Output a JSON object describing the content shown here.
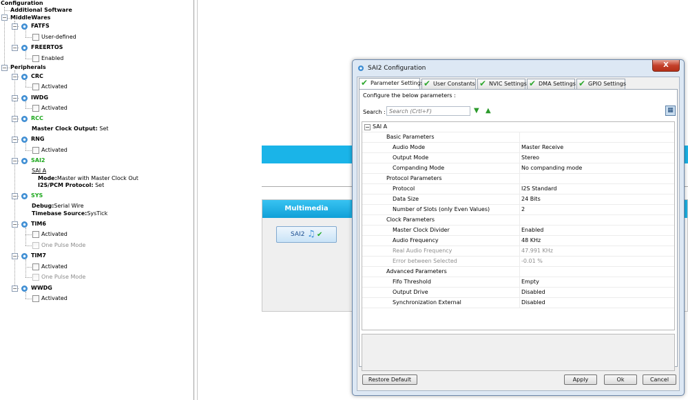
{
  "tree": {
    "root": "Configuration",
    "items": [
      {
        "label": "Additional Software"
      },
      {
        "label": "MiddleWares"
      },
      {
        "label": "FATFS"
      },
      {
        "label": "User-defined"
      },
      {
        "label": "FREERTOS"
      },
      {
        "label": "Enabled"
      },
      {
        "label": "Peripherals"
      },
      {
        "label": "CRC"
      },
      {
        "label": "Activated"
      },
      {
        "label": "IWDG"
      },
      {
        "label": "Activated"
      },
      {
        "label": "RCC"
      },
      {
        "label": "Master Clock Output:",
        "value": "Set"
      },
      {
        "label": "RNG"
      },
      {
        "label": "Activated"
      },
      {
        "label": "SAI2"
      },
      {
        "label": "SAI A"
      },
      {
        "label": "Mode:",
        "value": "Master with Master Clock Out"
      },
      {
        "label": "I2S/PCM Protocol:",
        "value": "Set"
      },
      {
        "label": "SYS"
      },
      {
        "label": "Debug:",
        "value": "Serial Wire"
      },
      {
        "label": "Timebase Source:",
        "value": "SysTick"
      },
      {
        "label": "TIM6"
      },
      {
        "label": "Activated"
      },
      {
        "label": "One Pulse Mode"
      },
      {
        "label": "TIM7"
      },
      {
        "label": "Activated"
      },
      {
        "label": "One Pulse Mode"
      },
      {
        "label": "WWDG"
      },
      {
        "label": "Activated"
      }
    ]
  },
  "multimedia": {
    "header": "Multimedia",
    "button_label": "SAI2"
  },
  "dialog": {
    "title": "SAI2 Configuration",
    "close_label": "X",
    "tabs": [
      {
        "label": "Parameter Settings"
      },
      {
        "label": "User Constants"
      },
      {
        "label": "NVIC Settings"
      },
      {
        "label": "DMA Settings"
      },
      {
        "label": "GPIO Settings"
      }
    ],
    "configure_label": "Configure the below parameters :",
    "search_label": "Search :",
    "search_placeholder": "Search (Crtl+F)",
    "section": "SAI A",
    "rows": [
      {
        "name": "Basic Parameters",
        "value": ""
      },
      {
        "name": "Audio Mode",
        "value": "Master Receive"
      },
      {
        "name": "Output Mode",
        "value": "Stereo"
      },
      {
        "name": "Companding Mode",
        "value": "No companding mode"
      },
      {
        "name": "Protocol Parameters",
        "value": ""
      },
      {
        "name": "Protocol",
        "value": "I2S Standard"
      },
      {
        "name": "Data Size",
        "value": "24 Bits"
      },
      {
        "name": "Number of Slots (only Even Values)",
        "value": "2"
      },
      {
        "name": "Clock Parameters",
        "value": ""
      },
      {
        "name": "Master Clock Divider",
        "value": "Enabled"
      },
      {
        "name": "Audio Frequency",
        "value": "48 KHz"
      },
      {
        "name": "Real Audio Frequency",
        "value": "47.991 KHz"
      },
      {
        "name": "Error between Selected",
        "value": "-0.01 %"
      },
      {
        "name": "Advanced Parameters",
        "value": ""
      },
      {
        "name": "Fifo Threshold",
        "value": "Empty"
      },
      {
        "name": "Output Drive",
        "value": "Disabled"
      },
      {
        "name": "Synchronization External",
        "value": "Disabled"
      }
    ],
    "buttons": {
      "restore": "Restore Default",
      "apply": "Apply",
      "ok": "Ok",
      "cancel": "Cancel"
    }
  }
}
